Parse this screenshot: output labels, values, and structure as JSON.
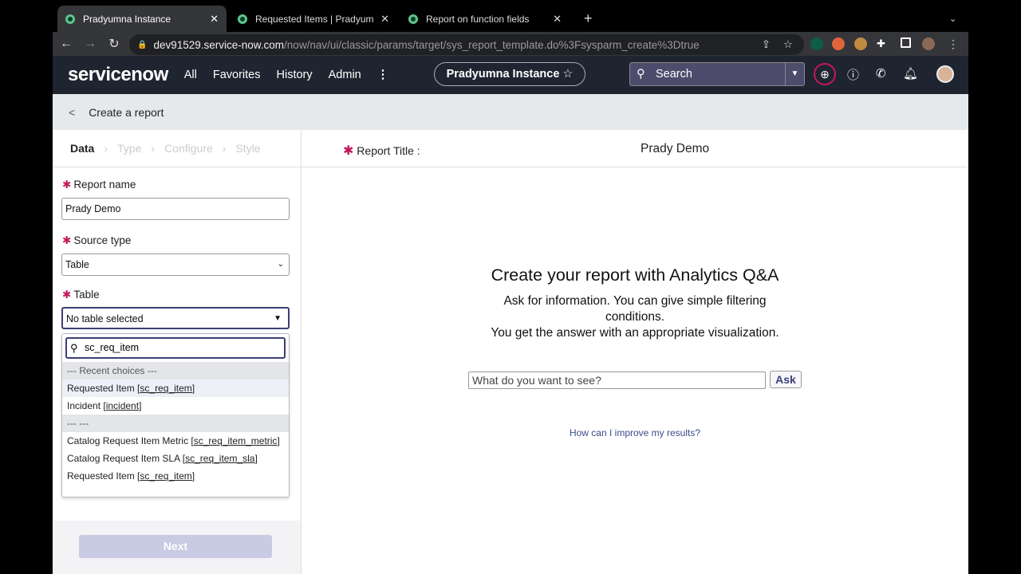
{
  "browser": {
    "tabs": [
      {
        "title": "Pradyumna Instance",
        "active": true
      },
      {
        "title": "Requested Items | Pradyumna",
        "active": false
      },
      {
        "title": "Report on function fields",
        "active": false
      }
    ],
    "url_host": "dev91529.service-now.com",
    "url_path": "/now/nav/ui/classic/params/target/sys_report_template.do%3Fsysparm_create%3Dtrue"
  },
  "topnav": {
    "logo": "servicenow",
    "items": [
      "All",
      "Favorites",
      "History",
      "Admin"
    ],
    "instance": "Pradyumna Instance",
    "search_placeholder": "Search"
  },
  "header": {
    "title": "Create a report"
  },
  "steps": [
    "Data",
    "Type",
    "Configure",
    "Style"
  ],
  "form": {
    "report_name_label": "Report name",
    "report_name_value": "Prady Demo",
    "source_type_label": "Source type",
    "source_type_value": "Table",
    "table_label": "Table",
    "table_value": "No table selected",
    "table_search": "sc_req_item",
    "options": [
      {
        "text": "--- Recent choices ---",
        "group": true
      },
      {
        "name": "Requested Item",
        "code": "sc_req_item"
      },
      {
        "name": "Incident",
        "code": "incident"
      },
      {
        "text": "--- ---",
        "group": true
      },
      {
        "name": "Catalog Request Item Metric",
        "code": "sc_req_item_metric"
      },
      {
        "name": "Catalog Request Item SLA",
        "code": "sc_req_item_sla"
      },
      {
        "name": "Requested Item",
        "code": "sc_req_item"
      }
    ],
    "next_label": "Next"
  },
  "main": {
    "report_title_label": "Report Title :",
    "report_title_value": "Prady Demo",
    "qa_heading": "Create your report with Analytics Q&A",
    "qa_text1": "Ask for information. You can give simple filtering conditions.",
    "qa_text2": "You get the answer with an appropriate visualization.",
    "ask_placeholder": "What do you want to see?",
    "ask_label": "Ask",
    "improve_link": "How can I improve my results?"
  }
}
